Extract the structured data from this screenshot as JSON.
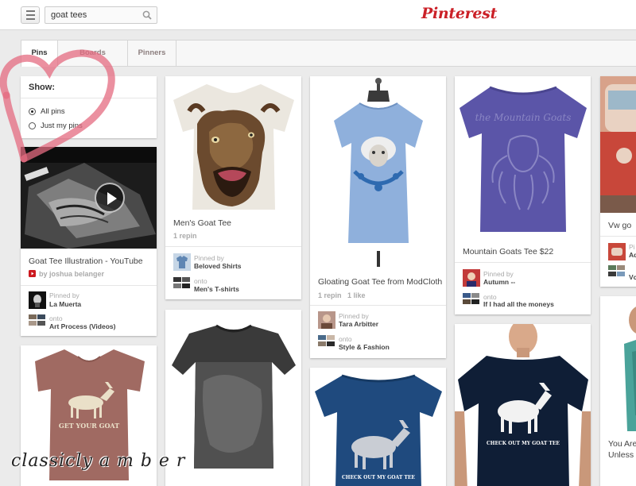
{
  "header": {
    "search_value": "goat tees",
    "logo": "Pinterest"
  },
  "tabs": [
    {
      "label": "Pins"
    },
    {
      "label": "Boards"
    },
    {
      "label": "Pinners"
    }
  ],
  "show_panel": {
    "title": "Show:",
    "options": [
      {
        "label": "All pins",
        "selected": true
      },
      {
        "label": "Just my pins",
        "selected": false
      }
    ]
  },
  "pins": {
    "youtube": {
      "description": "Goat Tee Illustration - YouTube",
      "byline": "by joshua belanger",
      "pinned_by_label": "Pinned by",
      "pinned_by": "La Muerta",
      "onto_label": "onto",
      "board": "Art Process (Videos)"
    },
    "mens_goat": {
      "description": "Men's Goat Tee",
      "repins": "1 repin",
      "pinned_by_label": "Pinned by",
      "pinned_by": "Beloved Shirts",
      "onto_label": "onto",
      "board": "Men's T-shirts"
    },
    "modcloth": {
      "description": "Gloating Goat Tee from ModCloth",
      "stats": "1 repin   1 like",
      "pinned_by_label": "Pinned by",
      "pinned_by": "Tara Arbitter",
      "onto_label": "onto",
      "board": "Style & Fashion"
    },
    "mountain": {
      "description": "Mountain Goats Tee $22",
      "shirt_text": "the Mountain Goats",
      "pinned_by_label": "Pinned by",
      "pinned_by": "Autumn --",
      "onto_label": "onto",
      "board": "If I had all the moneys"
    },
    "vw": {
      "description": "Vw go",
      "partial_1": "Pi",
      "partial_2": "Ad",
      "partial_3": "Vc"
    },
    "get_your_goat": {
      "shirt_text": "GET YOUR GOAT"
    },
    "check_out": {
      "shirt_text": "CHECK OUT MY GOAT TEE"
    },
    "model_tee": {
      "shirt_text": "CHECK OUT MY GOAT TEE"
    },
    "partial_right": {
      "line1": "You Are",
      "line2": "Unless Y"
    }
  },
  "watermark": "classicly a m b e r",
  "colors": {
    "brand_red": "#cb2027",
    "background": "#ebebeb",
    "heart_pink": "#e46b80"
  }
}
